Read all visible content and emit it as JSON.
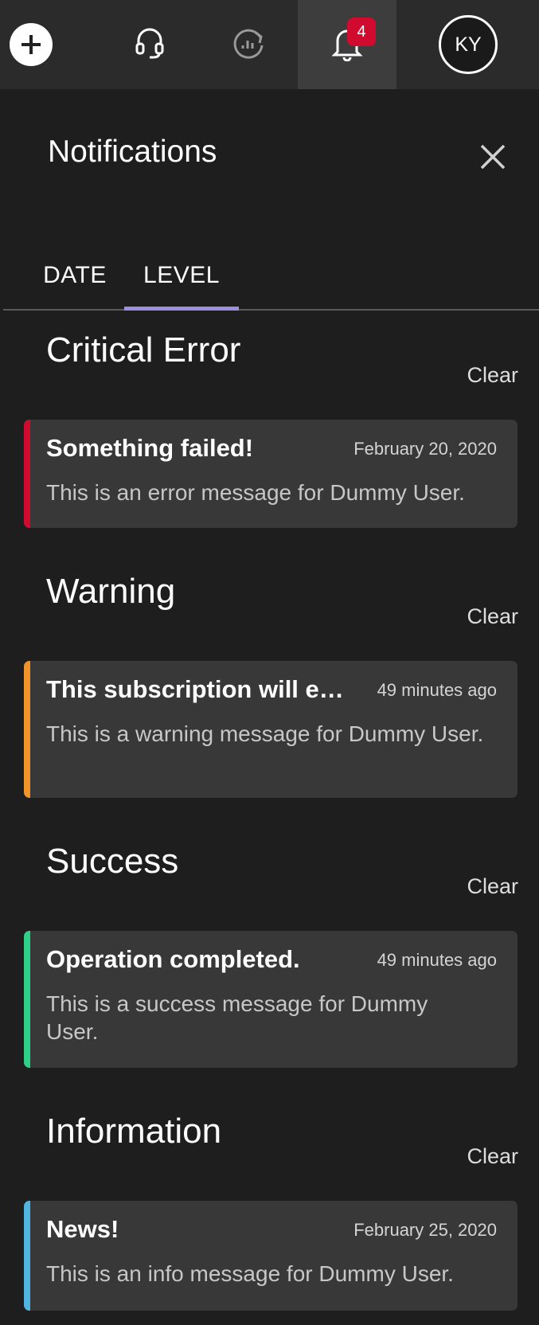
{
  "topbar": {
    "add_icon": "plus-circle-icon",
    "support_icon": "headset-icon",
    "analytics_icon": "chart-refresh-icon",
    "notifications_icon": "bell-icon",
    "notifications_count": "4",
    "profile_initials": "KY",
    "badge_color": "#d10a30"
  },
  "panel": {
    "title": "Notifications",
    "close_icon": "close-icon",
    "tabs": [
      {
        "label": "DATE",
        "active": false
      },
      {
        "label": "LEVEL",
        "active": true
      }
    ],
    "tab_indicator_color": "#9c8fe0",
    "sections": [
      {
        "title": "Critical Error",
        "clear_label": "Clear",
        "accent": "#d10a30",
        "items": [
          {
            "title": "Something failed!",
            "time": "February 20, 2020",
            "message": "This is an error message for Dummy User."
          }
        ]
      },
      {
        "title": "Warning",
        "clear_label": "Clear",
        "accent": "#f0932b",
        "items": [
          {
            "title": "This subscription will expi...",
            "time": "49 minutes ago",
            "message": "This is a warning message for Dummy User."
          }
        ]
      },
      {
        "title": "Success",
        "clear_label": "Clear",
        "accent": "#2ecf87",
        "items": [
          {
            "title": "Operation completed.",
            "time": "49 minutes ago",
            "message": "This is a success message for Dummy User."
          }
        ]
      },
      {
        "title": "Information",
        "clear_label": "Clear",
        "accent": "#4fb4e0",
        "items": [
          {
            "title": "News!",
            "time": "February 25, 2020",
            "message": "This is an info message for Dummy User."
          }
        ]
      }
    ]
  }
}
